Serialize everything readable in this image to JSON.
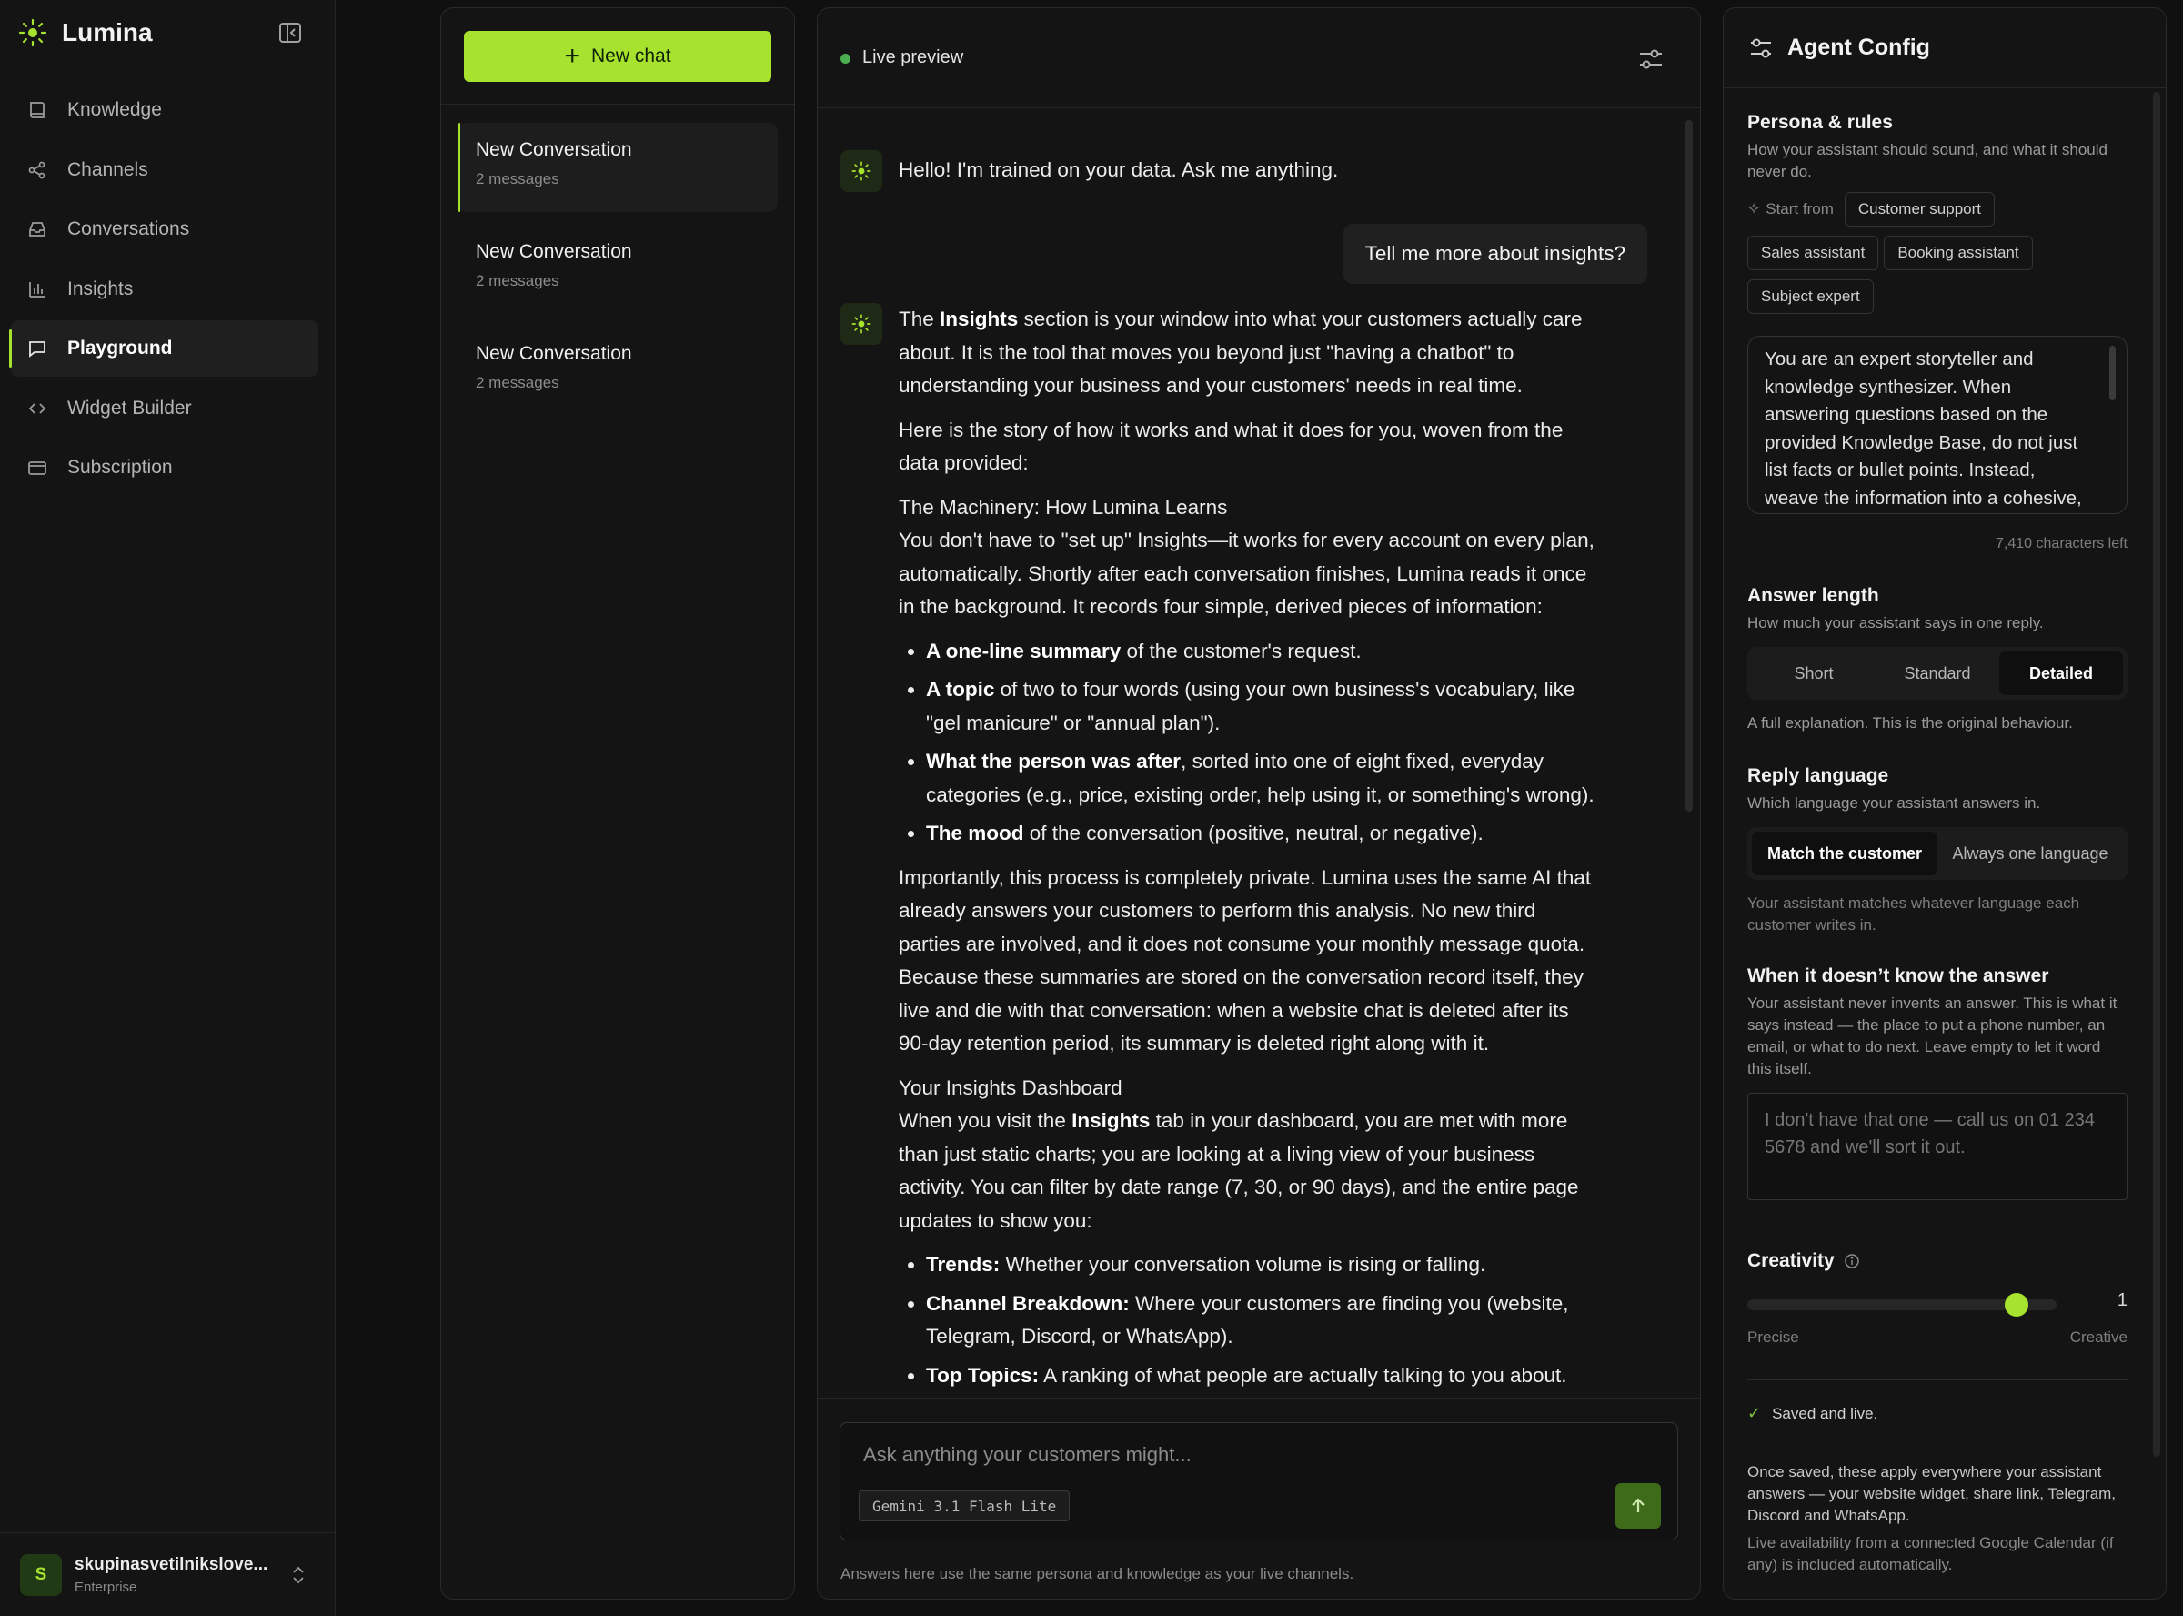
{
  "app": {
    "name": "Lumina"
  },
  "sidebar": {
    "items": [
      {
        "label": "Knowledge",
        "icon": "book-icon"
      },
      {
        "label": "Channels",
        "icon": "share-icon"
      },
      {
        "label": "Conversations",
        "icon": "inbox-icon"
      },
      {
        "label": "Insights",
        "icon": "bar-chart-icon"
      },
      {
        "label": "Playground",
        "icon": "chat-icon"
      },
      {
        "label": "Widget Builder",
        "icon": "code-icon"
      },
      {
        "label": "Subscription",
        "icon": "card-icon"
      }
    ],
    "active": "Playground",
    "user": {
      "initial": "S",
      "name": "skupinasvetilnikslove...",
      "plan": "Enterprise"
    }
  },
  "conversations": {
    "new_chat_label": "New chat",
    "items": [
      {
        "title": "New Conversation",
        "subtitle": "2 messages"
      },
      {
        "title": "New Conversation",
        "subtitle": "2 messages"
      },
      {
        "title": "New Conversation",
        "subtitle": "2 messages"
      }
    ]
  },
  "chat": {
    "header_label": "Live preview",
    "greeting": "Hello! I'm trained on your data. Ask me anything.",
    "user_message": "Tell me more about insights?",
    "answer": {
      "p1_a": "The ",
      "p1_b": "Insights",
      "p1_c": " section is your window into what your customers actually care about. It is the tool that moves you beyond just \"having a chatbot\" to understanding your business and your customers' needs in real time.",
      "p2": "Here is the story of how it works and what it does for you, woven from the data provided:",
      "h1": "The Machinery: How Lumina Learns",
      "p3": "You don't have to \"set up\" Insights—it works for every account on every plan, automatically. Shortly after each conversation finishes, Lumina reads it once in the background. It records four simple, derived pieces of information:",
      "list1": [
        {
          "bold": "A one-line summary",
          "rest": " of the customer's request."
        },
        {
          "bold": "A topic",
          "rest": " of two to four words (using your own business's vocabulary, like \"gel manicure\" or \"annual plan\")."
        },
        {
          "bold": "What the person was after",
          "rest": ", sorted into one of eight fixed, everyday categories (e.g., price, existing order, help using it, or something's wrong)."
        },
        {
          "bold": "The mood",
          "rest": " of the conversation (positive, neutral, or negative)."
        }
      ],
      "p4": "Importantly, this process is completely private. Lumina uses the same AI that already answers your customers to perform this analysis. No new third parties are involved, and it does not consume your monthly message quota. Because these summaries are stored on the conversation record itself, they live and die with that conversation: when a website chat is deleted after its 90-day retention period, its summary is deleted right along with it.",
      "h2": "Your Insights Dashboard",
      "p5_a": "When you visit the ",
      "p5_b": "Insights",
      "p5_c": " tab in your dashboard, you are met with more than just static charts; you are looking at a living view of your business activity. You can filter by date range (7, 30, or 90 days), and the entire page updates to show you:",
      "list2": [
        {
          "bold": "Trends:",
          "rest": " Whether your conversation volume is rising or falling."
        },
        {
          "bold": "Channel Breakdown:",
          "rest": " Where your customers are finding you (website, Telegram, Discord, or WhatsApp)."
        },
        {
          "bold": "Top Topics:",
          "rest": " A ranking of what people are actually talking to you about."
        }
      ]
    },
    "composer_placeholder": "Ask anything your customers might...",
    "model": "Gemini 3.1 Flash Lite",
    "note": "Answers here use the same persona and knowledge as your live channels."
  },
  "config": {
    "title": "Agent Config",
    "persona": {
      "heading": "Persona & rules",
      "description": "How your assistant should sound, and what it should never do.",
      "start_from": "Start from",
      "templates": [
        "Customer support",
        "Sales assistant",
        "Booking assistant",
        "Subject expert"
      ],
      "text": "You are an expert storyteller and knowledge synthesizer. When answering questions based on the provided Knowledge Base, do not just list facts or bullet points. Instead, weave the information into a cohesive,",
      "chars_left": "7,410 characters left"
    },
    "answer_length": {
      "heading": "Answer length",
      "description": "How much your assistant says in one reply.",
      "options": [
        "Short",
        "Standard",
        "Detailed"
      ],
      "selected": "Detailed",
      "note": "A full explanation. This is the original behaviour."
    },
    "reply_language": {
      "heading": "Reply language",
      "description": "Which language your assistant answers in.",
      "options": [
        "Match the customer",
        "Always one language"
      ],
      "selected": "Match the customer",
      "note": "Your assistant matches whatever language each customer writes in."
    },
    "fallback": {
      "heading": "When it doesn’t know the answer",
      "description": "Your assistant never invents an answer. This is what it says instead — the place to put a phone number, an email, or what to do next. Leave empty to let it word this itself.",
      "placeholder": "I don't have that one — call us on 01 234 5678 and we'll sort it out."
    },
    "creativity": {
      "heading": "Creativity",
      "value": "1",
      "level": 0.9,
      "min_label": "Precise",
      "max_label": "Creative"
    },
    "status": "Saved and live.",
    "footer": "Once saved, these apply everywhere your assistant answers — your website widget, share link, Telegram, Discord and WhatsApp.",
    "footer2": "Live availability from a connected Google Calendar (if any) is included automatically.",
    "accent": "#a6e22e"
  }
}
